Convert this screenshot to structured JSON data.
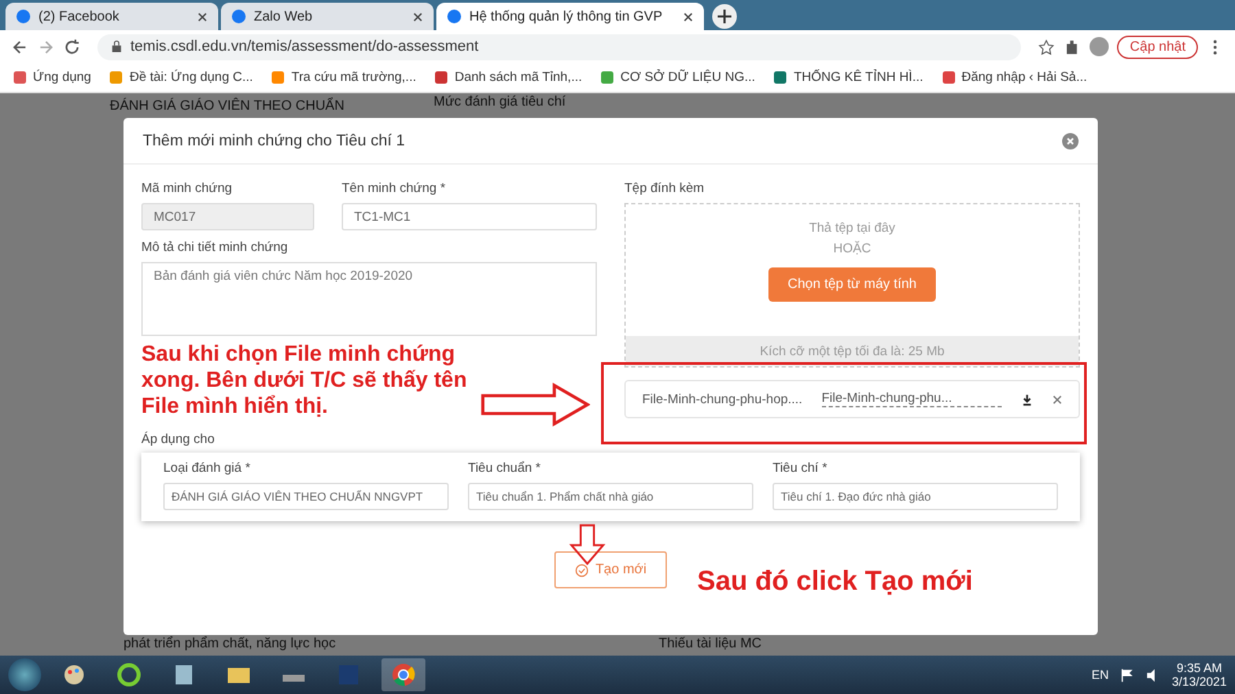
{
  "browser": {
    "tabs": [
      {
        "title": "(2) Facebook",
        "selected": false
      },
      {
        "title": "Zalo Web",
        "selected": false
      },
      {
        "title": "Hệ thống quản lý thông tin GVP",
        "selected": true
      }
    ],
    "address": "temis.csdl.edu.vn/temis/assessment/do-assessment",
    "update_button": "Cập nhật",
    "bookmarks": [
      "Ứng dụng",
      "Đề tài: Ứng dụng C...",
      "Tra cứu mã trường,...",
      "Danh sách mã Tỉnh,...",
      "CƠ SỞ DỮ LIỆU NG...",
      "THỐNG KÊ TỈNH HÌ...",
      "Đăng nhập ‹ Hải Sả..."
    ]
  },
  "background_page": {
    "heading": "ĐÁNH GIÁ GIÁO VIÊN THEO CHUẨN",
    "column_header": "Mức đánh giá tiêu chí",
    "row_text": "phát triển phẩm chất, năng lực học",
    "status_text": "Thiếu tài liệu MC"
  },
  "modal": {
    "title": "Thêm mới minh chứng cho Tiêu chí 1",
    "code": {
      "label": "Mã minh chứng",
      "value": "MC017",
      "disabled": true
    },
    "name": {
      "label": "Tên minh chứng *",
      "value": "TC1-MC1"
    },
    "description": {
      "label": "Mô tả chi tiết minh chứng",
      "value": "Bản đánh giá viên chức Năm học 2019-2020"
    },
    "attachment": {
      "label": "Tệp đính kèm",
      "drop_text": "Thả tệp tại đây",
      "or_text": "HOẶC",
      "choose_button": "Chọn tệp từ máy tính",
      "size_note": "Kích cỡ một tệp tối đa là: 25 Mb",
      "files": [
        {
          "name": "File-Minh-chung-phu-hop....",
          "link": "File-Minh-chung-phu..."
        }
      ]
    },
    "apply_section": {
      "label": "Áp dụng cho",
      "fields": [
        {
          "label": "Loại đánh giá *",
          "value": "ĐÁNH GIÁ GIÁO VIÊN THEO CHUẨN NNGVPT"
        },
        {
          "label": "Tiêu chuẩn *",
          "value": "Tiêu chuẩn 1. Phẩm chất nhà giáo"
        },
        {
          "label": "Tiêu chí *",
          "value": "Tiêu chí 1. Đạo đức nhà giáo"
        }
      ]
    },
    "create_button": "Tạo mới"
  },
  "annotations": [
    {
      "text": "Sau khi chọn File minh chứng xong. Bên dưới T/C sẽ thấy tên File mình hiển thị."
    },
    {
      "text": "Sau đó click Tạo mới"
    }
  ],
  "taskbar": {
    "language": "EN",
    "time": "9:35 AM",
    "date": "3/13/2021"
  }
}
